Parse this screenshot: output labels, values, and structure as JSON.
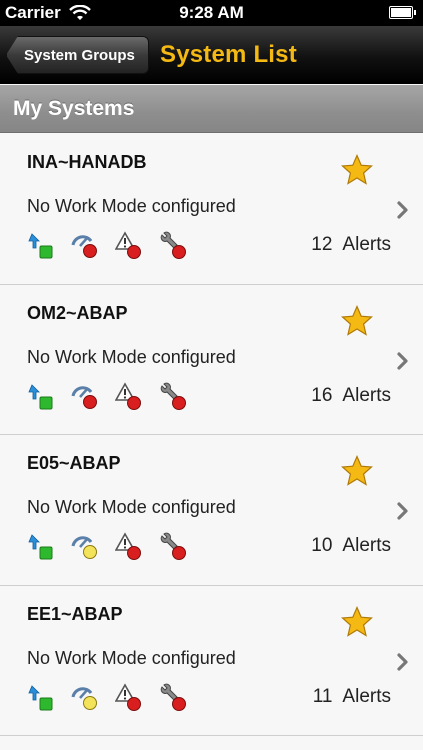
{
  "status_bar": {
    "carrier": "Carrier",
    "time": "9:28 AM"
  },
  "nav": {
    "back_label": "System Groups",
    "title": "System List"
  },
  "section_title": "My Systems",
  "systems": [
    {
      "name": "INA~HANADB",
      "mode": "No Work Mode configured",
      "alert_count": "12",
      "alert_word": "Alerts",
      "status": {
        "availability": "green",
        "performance": "red",
        "exceptions": "red",
        "configuration": "red"
      }
    },
    {
      "name": "OM2~ABAP",
      "mode": "No Work Mode configured",
      "alert_count": "16",
      "alert_word": "Alerts",
      "status": {
        "availability": "green",
        "performance": "red",
        "exceptions": "red",
        "configuration": "red"
      }
    },
    {
      "name": "E05~ABAP",
      "mode": "No Work Mode configured",
      "alert_count": "10",
      "alert_word": "Alerts",
      "status": {
        "availability": "green",
        "performance": "yellow",
        "exceptions": "red",
        "configuration": "red"
      }
    },
    {
      "name": "EE1~ABAP",
      "mode": "No Work Mode configured",
      "alert_count": "11",
      "alert_word": "Alerts",
      "status": {
        "availability": "green",
        "performance": "yellow",
        "exceptions": "red",
        "configuration": "red"
      }
    }
  ],
  "colors": {
    "nav_title": "#f5b914",
    "status_green": "#2db82d",
    "status_red": "#d81e1e",
    "status_yellow": "#f3e35a",
    "star": "#f5b914"
  }
}
